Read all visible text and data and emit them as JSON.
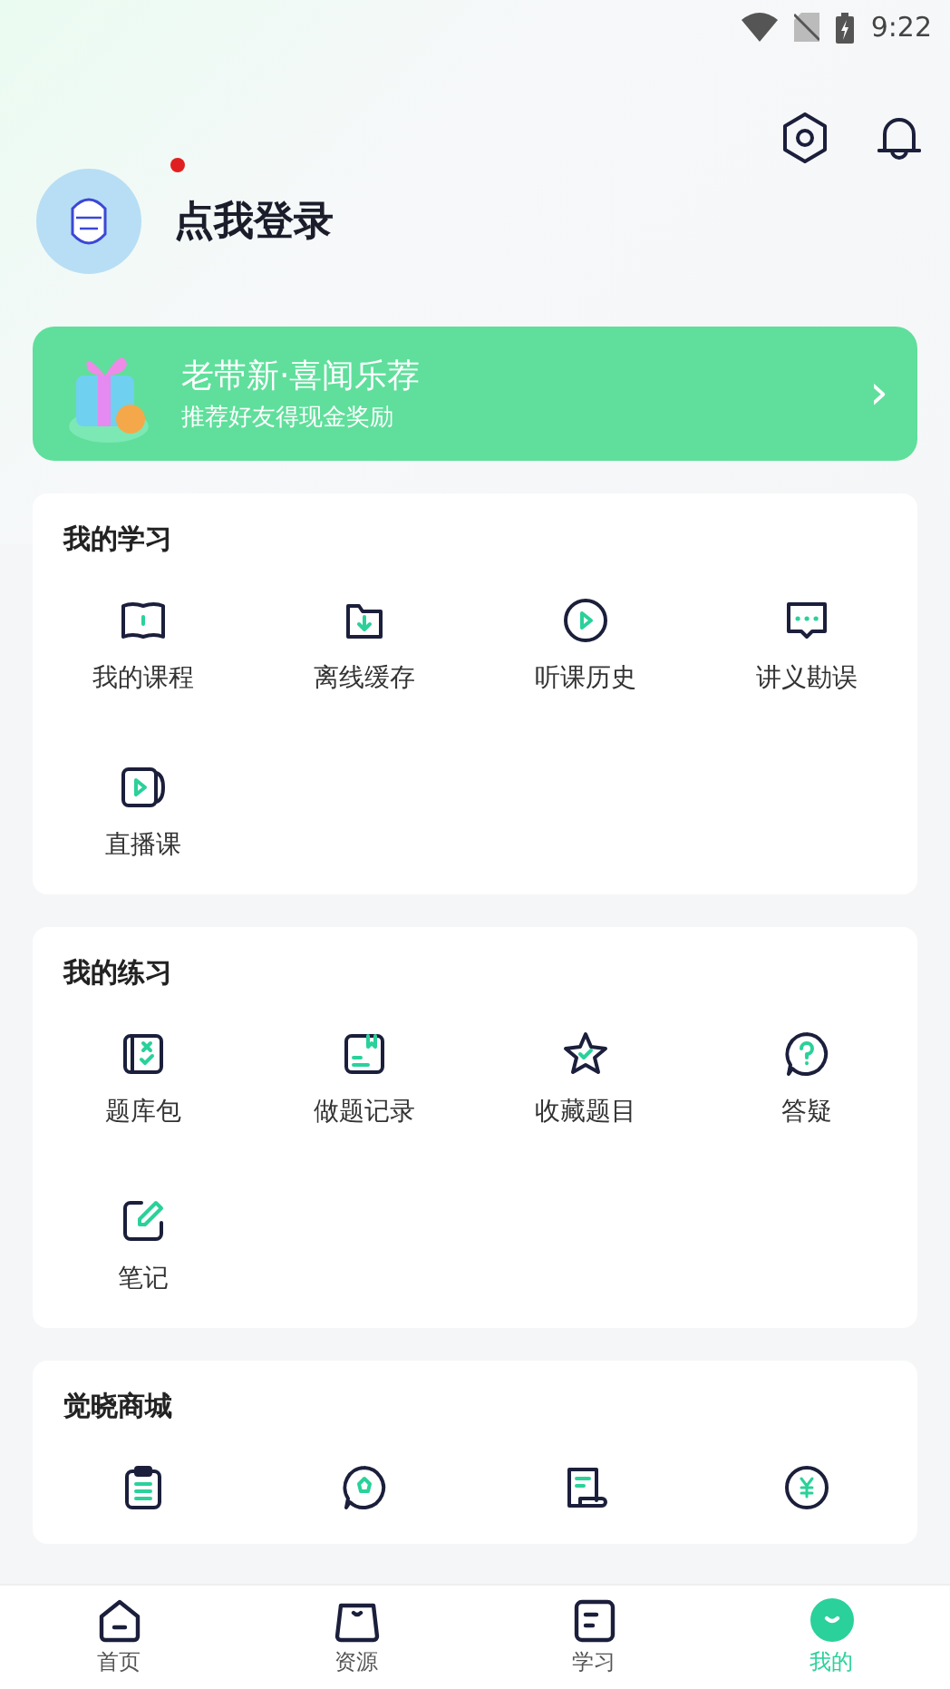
{
  "status_bar": {
    "time": "9:22"
  },
  "profile": {
    "login_prompt": "点我登录",
    "has_notice": true
  },
  "banner": {
    "title": "老带新·喜闻乐荐",
    "subtitle": "推荐好友得现金奖励",
    "chevron": "›"
  },
  "sections": [
    {
      "title": "我的学习",
      "items": [
        {
          "label": "我的课程"
        },
        {
          "label": "离线缓存"
        },
        {
          "label": "听课历史"
        },
        {
          "label": "讲义勘误"
        },
        {
          "label": "直播课"
        }
      ]
    },
    {
      "title": "我的练习",
      "items": [
        {
          "label": "题库包"
        },
        {
          "label": "做题记录"
        },
        {
          "label": "收藏题目"
        },
        {
          "label": "答疑"
        },
        {
          "label": "笔记"
        }
      ]
    },
    {
      "title": "觉晓商城"
    }
  ],
  "tabs": [
    {
      "label": "首页",
      "selected": false
    },
    {
      "label": "资源",
      "selected": false
    },
    {
      "label": "学习",
      "selected": false
    },
    {
      "label": "我的",
      "selected": true
    }
  ]
}
